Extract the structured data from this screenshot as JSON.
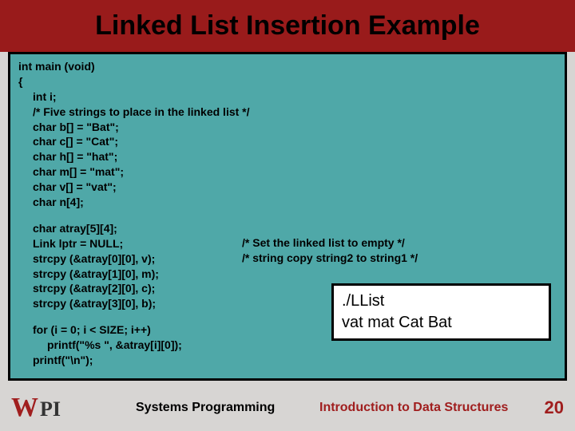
{
  "title": "Linked List Insertion Example",
  "code": {
    "l1": "int main (void)",
    "l2": "{",
    "l3": "int i;",
    "l4": "/* Five strings to place in the linked list */",
    "l5": "char b[] = \"Bat\";",
    "l6": "char c[] = \"Cat\";",
    "l7": "char h[] = \"hat\";",
    "l8": "char m[] = \"mat\";",
    "l9": "char v[] = \"vat\";",
    "l10": "char n[4];",
    "b2_1": "char atray[5][4];",
    "b2_2": "Link lptr = NULL;",
    "b2_3": "strcpy (&atray[0][0], v);",
    "b2_4": "strcpy (&atray[1][0], m);",
    "b2_5": "strcpy (&atray[2][0], c);",
    "b2_6": "strcpy (&atray[3][0], b);",
    "c1": "/* Set the linked list to empty   */",
    "c2": "/*  string copy string2 to string1 */",
    "b3_1": "for (i = 0; i < SIZE; i++)",
    "b3_2": "printf(\"%s \", &atray[i][0]);",
    "b3_3": "printf(\"\\n\");"
  },
  "output": {
    "l1": "./LList",
    "l2": "vat mat Cat Bat"
  },
  "footer": {
    "logo_w": "W",
    "logo_pi": "PI",
    "center": "Systems Programming",
    "right": "Introduction to Data Structures",
    "page": "20"
  }
}
